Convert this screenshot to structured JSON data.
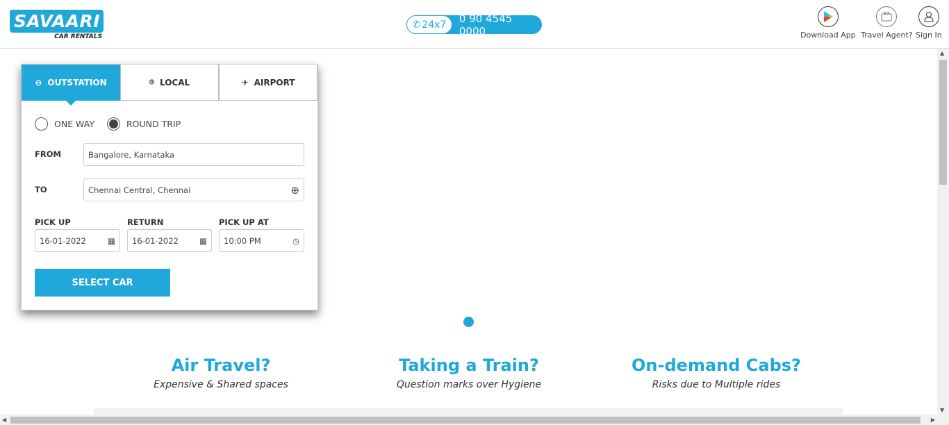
{
  "header": {
    "logo_title": "SAVAARI",
    "logo_sub": "CAR RENTALS",
    "phone_badge": "24x7",
    "phone_number": "0 90 4545 0000",
    "download_app": "Download App",
    "travel_agent": "Travel Agent?",
    "sign_in": "Sign In"
  },
  "booking": {
    "tabs": [
      "OUTSTATION",
      "LOCAL",
      "AIRPORT"
    ],
    "trip_types": [
      "ONE WAY",
      "ROUND TRIP"
    ],
    "selected_trip": "ROUND TRIP",
    "from_label": "FROM",
    "from_value": "Bangalore, Karnataka",
    "to_label": "TO",
    "to_value": "Chennai Central, Chennai",
    "pickup_label": "PICK UP",
    "pickup_value": "16-01-2022",
    "return_label": "RETURN",
    "return_value": "16-01-2022",
    "time_label": "PICK UP AT",
    "time_value": "10:00 PM",
    "submit": "SELECT CAR"
  },
  "features": [
    {
      "title": "Air Travel?",
      "subtitle": "Expensive & Shared spaces"
    },
    {
      "title": "Taking a Train?",
      "subtitle": "Question marks over Hygiene"
    },
    {
      "title": "On-demand Cabs?",
      "subtitle": "Risks due to Multiple rides"
    }
  ],
  "colors": {
    "accent": "#1fa8d9"
  }
}
